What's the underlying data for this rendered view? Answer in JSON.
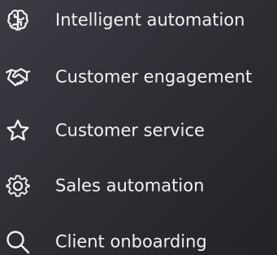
{
  "menu": {
    "items": [
      {
        "label": "Intelligent automation",
        "icon": "brain-icon"
      },
      {
        "label": "Customer engagement",
        "icon": "handshake-icon"
      },
      {
        "label": "Customer service",
        "icon": "star-icon"
      },
      {
        "label": "Sales automation",
        "icon": "gear-icon"
      },
      {
        "label": "Client onboarding",
        "icon": "search-icon"
      }
    ]
  },
  "colors": {
    "text": "#f2f2f2",
    "icon": "#f2f2f2",
    "background_start": "#3b3c44",
    "background_end": "#222328"
  }
}
